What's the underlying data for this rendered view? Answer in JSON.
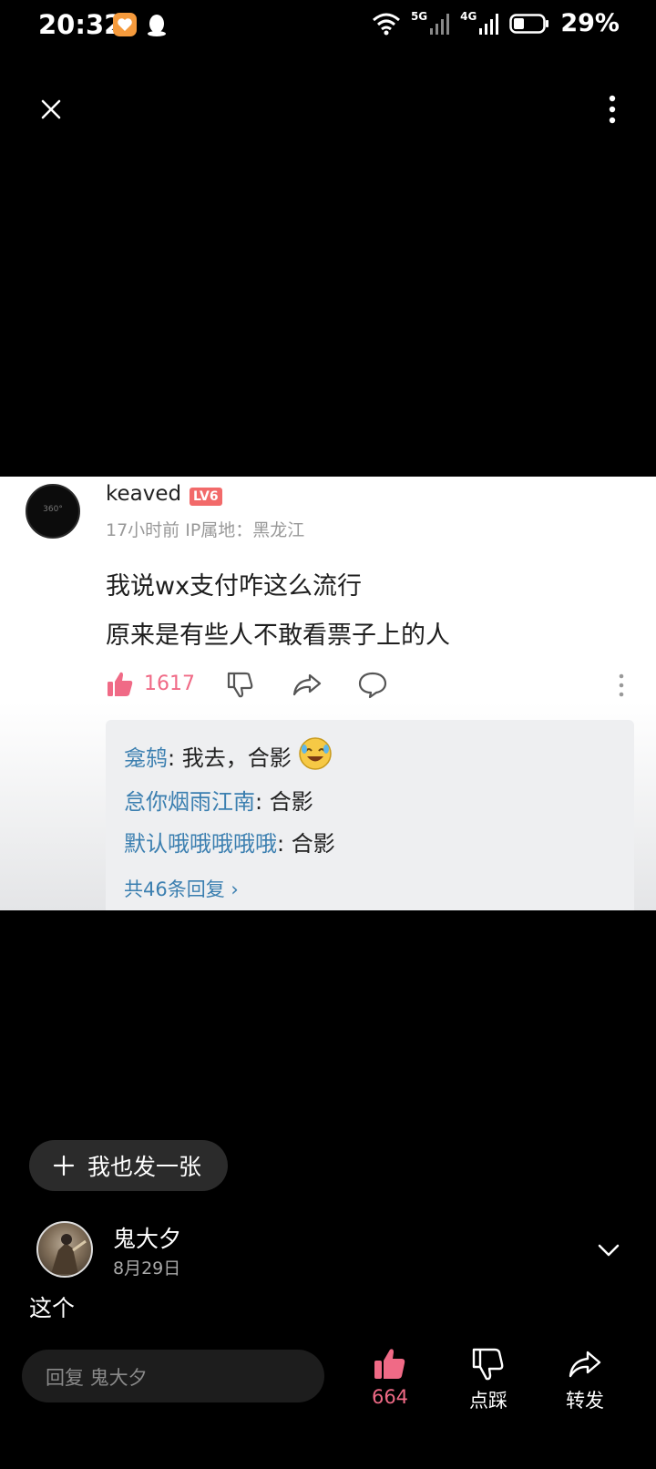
{
  "status_bar": {
    "time": "20:32",
    "net1": "5G",
    "net2": "4G",
    "battery": "29%"
  },
  "icons": {
    "close": "close-icon",
    "more": "more-vertical-icon",
    "like": "thumbs-up-icon",
    "dislike": "thumbs-down-icon",
    "share": "share-arrow-icon",
    "comment": "comment-bubble-icon"
  },
  "screenshot": {
    "username": "keaved",
    "level": "LV6",
    "meta": "17小时前 IP属地：黑龙江",
    "text_line1": "我说wx支付咋这么流行",
    "text_line2": "原来是有些人不敢看票子上的人",
    "like_count": "1617",
    "replies": [
      {
        "nick": "龛鸫",
        "text": ": 我去，合影"
      },
      {
        "nick": "怠你烟雨江南",
        "text": ": 合影"
      },
      {
        "nick": "默认哦哦哦哦哦",
        "text": ": 合影"
      }
    ],
    "reply_total": "共46条回复 ›"
  },
  "post_button": {
    "label": "我也发一张"
  },
  "post": {
    "author": "鬼大夕",
    "date": "8月29日",
    "caption": "这个"
  },
  "bottom_bar": {
    "reply_placeholder": "回复 鬼大夕",
    "like_count": "664",
    "dislike_label": "点踩",
    "share_label": "转发"
  },
  "colors": {
    "background": "#000000",
    "accent_pink": "#f06a86",
    "link_blue": "#3b7fb0"
  }
}
